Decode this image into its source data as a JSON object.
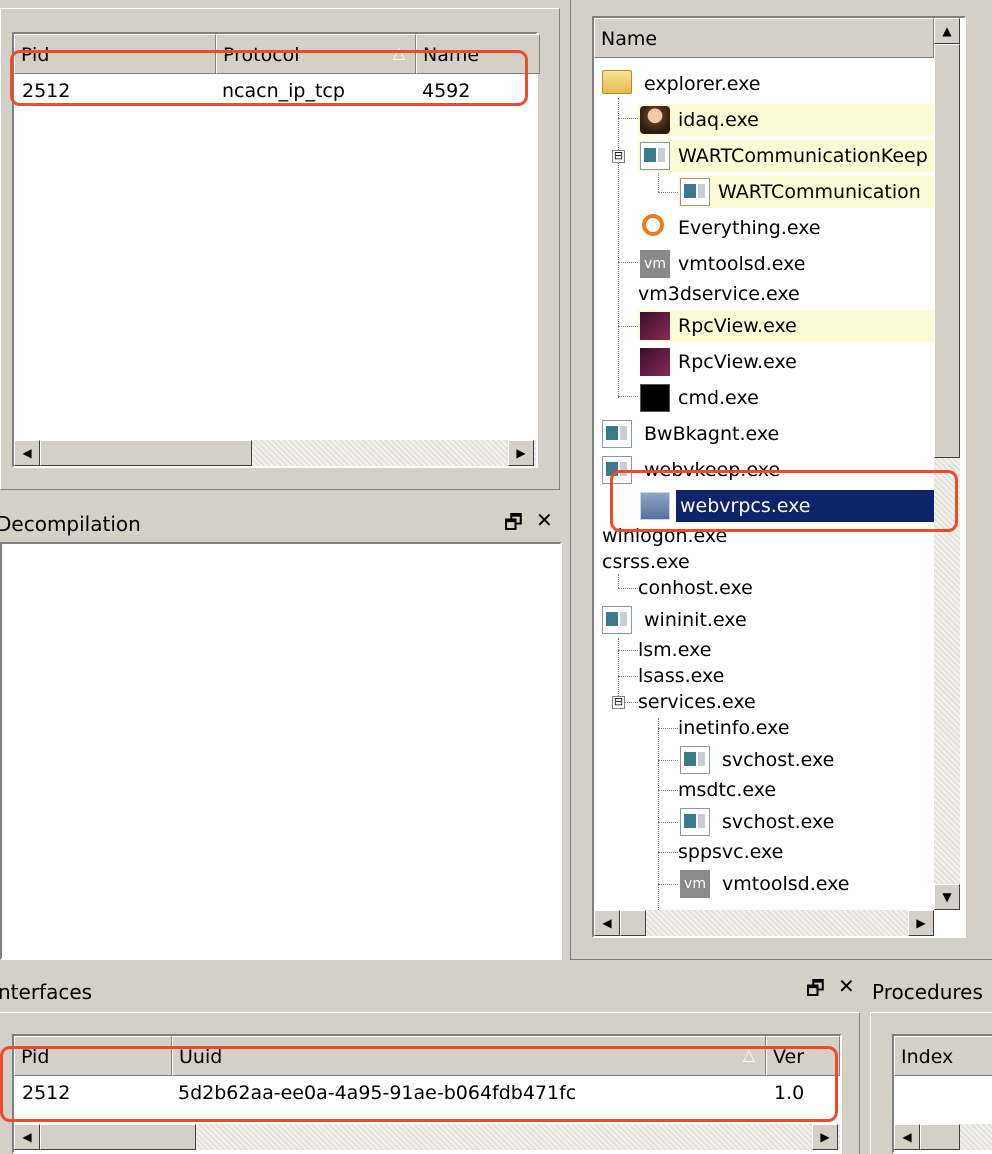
{
  "endpoints": {
    "columns": [
      "Pid",
      "Protocol",
      "Name"
    ],
    "rows": [
      {
        "pid": "2512",
        "protocol": "ncacn_ip_tcp",
        "name": "4592"
      }
    ]
  },
  "decompilation": {
    "title": "Decompilation"
  },
  "interfaces": {
    "title": "nterfaces",
    "columns": [
      "Pid",
      "Uuid",
      "Ver"
    ],
    "rows": [
      {
        "pid": "2512",
        "uuid": "5d2b62aa-ee0a-4a95-91ae-b064fdb471fc",
        "ver": "1.0"
      }
    ]
  },
  "procedures": {
    "title": "Procedures",
    "columns": [
      "Index"
    ]
  },
  "process_tree": {
    "header": "Name",
    "nodes": [
      {
        "label": "explorer.exe",
        "icon": "folder-icon"
      },
      {
        "label": "idaq.exe",
        "icon": "ida-icon"
      },
      {
        "label": "WARTCommunicationKeep",
        "icon": "window-icon"
      },
      {
        "label": "WARTCommunication",
        "icon": "window-icon"
      },
      {
        "label": "Everything.exe",
        "icon": "magnifier-icon"
      },
      {
        "label": "vmtoolsd.exe",
        "icon": "vmware-icon"
      },
      {
        "label": "vm3dservice.exe",
        "icon": ""
      },
      {
        "label": "RpcView.exe",
        "icon": "rpcview-icon"
      },
      {
        "label": "RpcView.exe",
        "icon": "rpcview-icon"
      },
      {
        "label": "cmd.exe",
        "icon": "console-icon"
      },
      {
        "label": "BwBkagnt.exe",
        "icon": "window-icon"
      },
      {
        "label": "webvkeep.exe",
        "icon": "window-icon"
      },
      {
        "label": "webvrpcs.exe",
        "icon": "network-icon"
      },
      {
        "label": "winlogon.exe",
        "icon": ""
      },
      {
        "label": "csrss.exe",
        "icon": ""
      },
      {
        "label": "conhost.exe",
        "icon": ""
      },
      {
        "label": "wininit.exe",
        "icon": "window-icon"
      },
      {
        "label": "lsm.exe",
        "icon": ""
      },
      {
        "label": "lsass.exe",
        "icon": ""
      },
      {
        "label": "services.exe",
        "icon": ""
      },
      {
        "label": "inetinfo.exe",
        "icon": ""
      },
      {
        "label": "svchost.exe",
        "icon": "window-icon"
      },
      {
        "label": "msdtc.exe",
        "icon": ""
      },
      {
        "label": "svchost.exe",
        "icon": "window-icon"
      },
      {
        "label": "sppsvc.exe",
        "icon": ""
      },
      {
        "label": "vmtoolsd.exe",
        "icon": "vmware-icon"
      }
    ]
  },
  "icons": {
    "expand_minus": "⊟",
    "restore": "🗗",
    "close": "✕",
    "arrow_up": "▲",
    "arrow_down": "▼",
    "arrow_left": "◀",
    "arrow_right": "▶",
    "sort_arrow": "△"
  },
  "colors": {
    "highlight_box": "#ee4b2b",
    "selection": "#0b246a",
    "row_highlight": "#fdfbd4"
  }
}
